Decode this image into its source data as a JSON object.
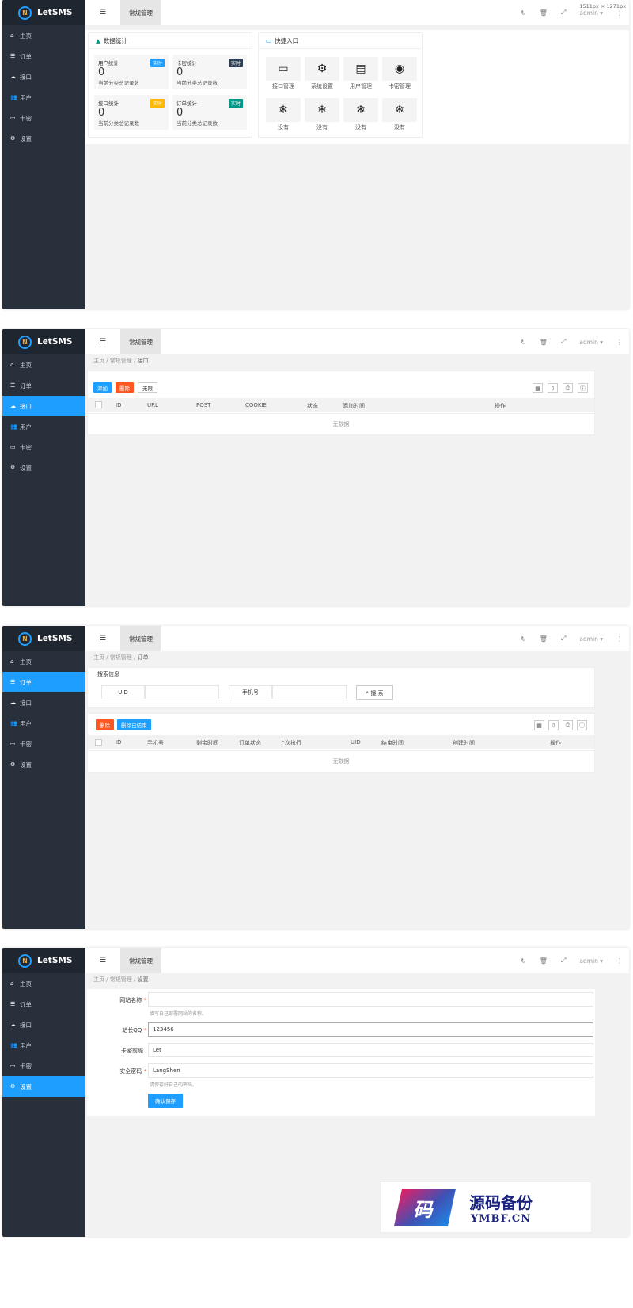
{
  "app": {
    "brand": "LetSMS",
    "admin": "admin",
    "tab": "常规管理",
    "viewport": "1511px × 1271px"
  },
  "nav": [
    "主页",
    "订单",
    "接口",
    "用户",
    "卡密",
    "设置"
  ],
  "crumbs": {
    "home": "主页",
    "group": "常规管理",
    "api": "接口",
    "orders": "订单",
    "settings": "设置"
  },
  "dashboard": {
    "stats_title": "数据统计",
    "quick_title": "快捷入口",
    "stats": [
      {
        "title": "用户统计",
        "badge": "实时",
        "value": "0",
        "desc": "当前分类总记录数",
        "color": "#1e9fff"
      },
      {
        "title": "卡密统计",
        "badge": "实时",
        "value": "0",
        "desc": "当前分类总记录数",
        "color": "#2f4056"
      },
      {
        "title": "接口统计",
        "badge": "实时",
        "value": "0",
        "desc": "当前分类总记录数",
        "color": "#ffb800"
      },
      {
        "title": "订单统计",
        "badge": "实时",
        "value": "0",
        "desc": "当前分类总记录数",
        "color": "#009688"
      }
    ],
    "quick": [
      "接口管理",
      "系统设置",
      "用户管理",
      "卡密管理",
      "没有",
      "没有",
      "没有",
      "没有"
    ]
  },
  "api_page": {
    "buttons": [
      "添加",
      "删除",
      "无限"
    ],
    "columns": [
      "ID",
      "URL",
      "POST",
      "COOKIE",
      "状态",
      "添加时间",
      "操作"
    ],
    "empty": "无数据"
  },
  "order_page": {
    "search_title": "搜索信息",
    "uid_label": "UID",
    "phone_label": "手机号",
    "search_btn": "搜 索",
    "buttons": [
      "删除",
      "删除已结束"
    ],
    "columns": [
      "ID",
      "手机号",
      "剩余时间",
      "订单状态",
      "上次执行",
      "UID",
      "结束时间",
      "创建时间",
      "操作"
    ],
    "empty": "无数据"
  },
  "settings": {
    "site_label": "网站名称",
    "site_value": "",
    "site_hint": "填写自己部署网站的名称。",
    "qq_label": "站长QQ",
    "qq_value": "123456",
    "prefix_label": "卡密前缀",
    "prefix_value": "Let",
    "pwd_label": "安全密码",
    "pwd_value": "LangShen",
    "pwd_hint": "请保存好自己的密码。",
    "submit": "确认保存"
  },
  "watermark": {
    "glyph": "码",
    "title": "源码备份",
    "sub": "YMBF.CN"
  }
}
